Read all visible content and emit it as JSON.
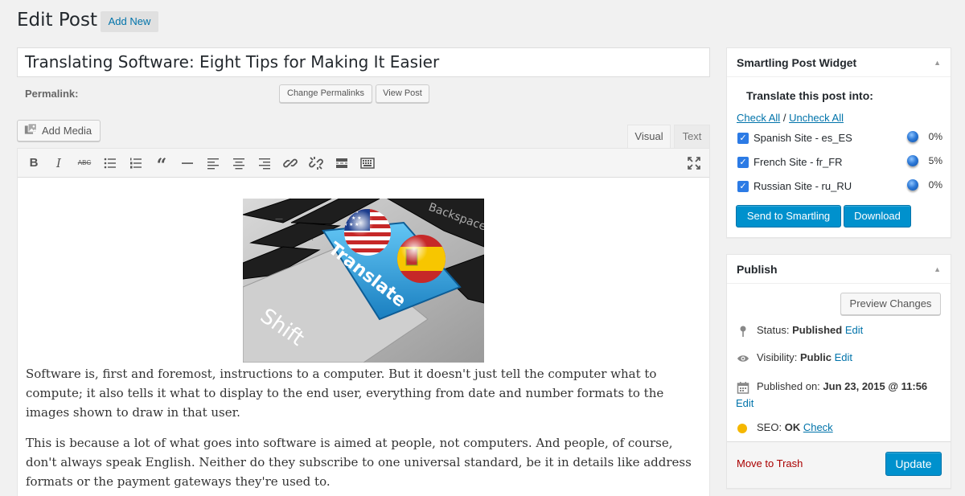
{
  "header": {
    "title": "Edit Post",
    "add_new": "Add New"
  },
  "post": {
    "title": "Translating Software: Eight Tips for Making It Easier",
    "permalink_label": "Permalink:",
    "change_permalinks": "Change Permalinks",
    "view_post": "View Post"
  },
  "editor": {
    "add_media": "Add Media",
    "tab_visual": "Visual",
    "tab_text": "Text",
    "toolbar": [
      "bold-icon",
      "italic-icon",
      "strikethrough-icon",
      "bullet-list-icon",
      "numbered-list-icon",
      "blockquote-icon",
      "horizontal-rule-icon",
      "align-left-icon",
      "align-center-icon",
      "align-right-icon",
      "link-icon",
      "unlink-icon",
      "read-more-icon",
      "toolbar-toggle-icon",
      "fullscreen-icon"
    ],
    "image_labels": {
      "key_main": "Translate",
      "key_side": "Shift",
      "key_top": "Backspace"
    },
    "paragraph1": "Software is, first and foremost, instructions to a computer. But it doesn't just tell the computer what to compute; it also tells it what to display to the end user, everything from date and number formats to the images shown to draw in that user.",
    "paragraph2": "This is because a lot of what goes into software is aimed at people, not computers. And people, of course, don't always speak English. Neither do they subscribe to one universal standard, be it in details like address formats or the payment gateways they're used to."
  },
  "smartling": {
    "title": "Smartling Post Widget",
    "subtitle": "Translate this post into:",
    "check_all": "Check All",
    "separator": "/",
    "uncheck_all": "Uncheck All",
    "languages": [
      {
        "name": "Spanish Site - es_ES",
        "percent": "0%",
        "checked": true
      },
      {
        "name": "French Site - fr_FR",
        "percent": "5%",
        "checked": true
      },
      {
        "name": "Russian Site - ru_RU",
        "percent": "0%",
        "checked": true
      }
    ],
    "send_button": "Send to Smartling",
    "download_button": "Download"
  },
  "publish": {
    "title": "Publish",
    "preview_button": "Preview Changes",
    "status_label": "Status:",
    "status_value": "Published",
    "visibility_label": "Visibility:",
    "visibility_value": "Public",
    "published_label": "Published on:",
    "published_value": "Jun 23, 2015 @ 11:56",
    "seo_label": "SEO:",
    "seo_value": "OK",
    "seo_check": "Check",
    "edit": "Edit",
    "trash": "Move to Trash",
    "update_button": "Update"
  },
  "colors": {
    "primary": "#0091cd",
    "link": "#0073aa",
    "danger": "#a00000",
    "seo_ok": "#f5b700"
  }
}
